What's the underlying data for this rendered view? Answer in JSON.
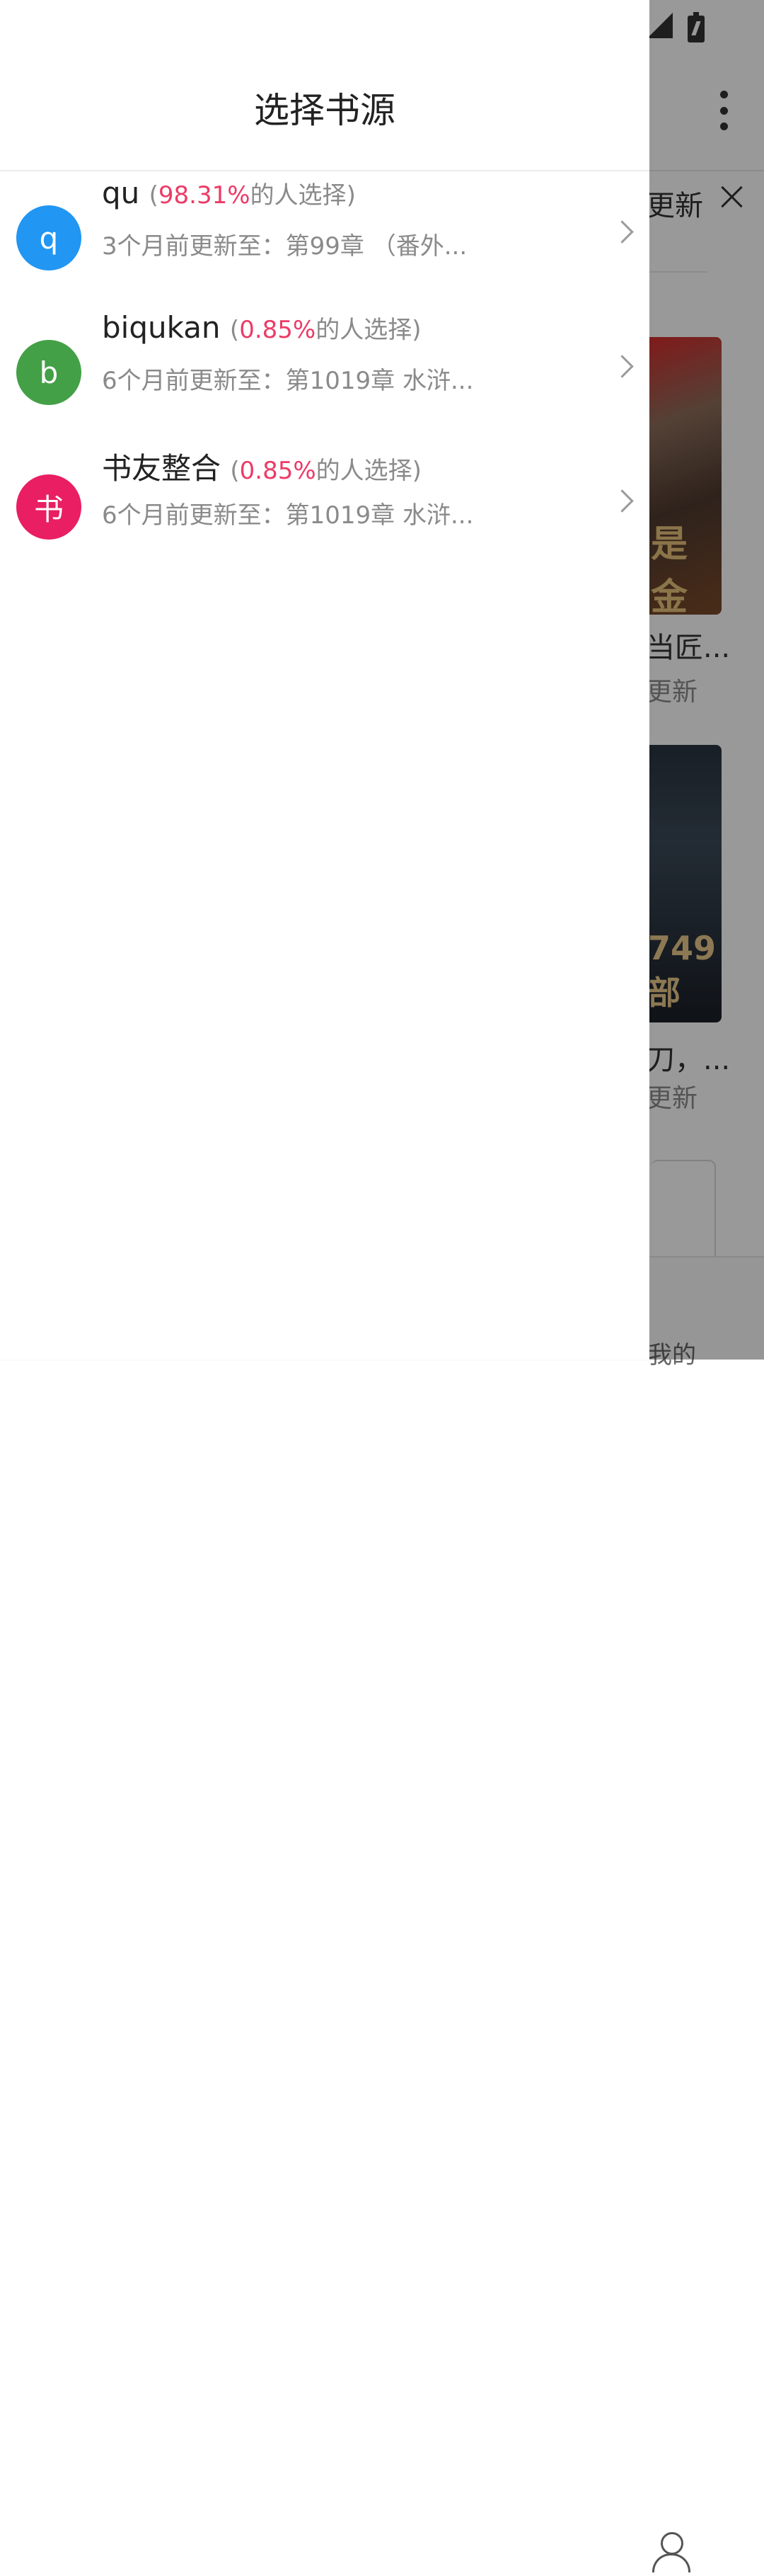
{
  "background": {
    "top_tab_text": "更新",
    "book1_title": "当匠...",
    "book1_status": "更新",
    "book1_cover_text": "是金",
    "book2_title": "刀，...",
    "book2_status": "更新",
    "book2_cover_text": "749 部",
    "bottom_nav_label": "我的"
  },
  "drawer": {
    "title": "选择书源",
    "sources": [
      {
        "avatar": "q",
        "avatar_color": "#2196F3",
        "name": "qu",
        "percent": "98.31%",
        "percent_suffix": "的人选择",
        "update": "3个月前更新至：第99章 （番外..."
      },
      {
        "avatar": "b",
        "avatar_color": "#43A047",
        "name": "biqukan",
        "percent": "0.85%",
        "percent_suffix": "的人选择",
        "update": "6个月前更新至：第1019章 水浒..."
      },
      {
        "avatar": "书",
        "avatar_color": "#E91E63",
        "name": "书友整合",
        "percent": "0.85%",
        "percent_suffix": "的人选择",
        "update": "6个月前更新至：第1019章 水浒..."
      }
    ]
  },
  "colors": {
    "percent_highlight": "#ec3b67",
    "scrim": "rgba(0,0,0,0.40)"
  }
}
